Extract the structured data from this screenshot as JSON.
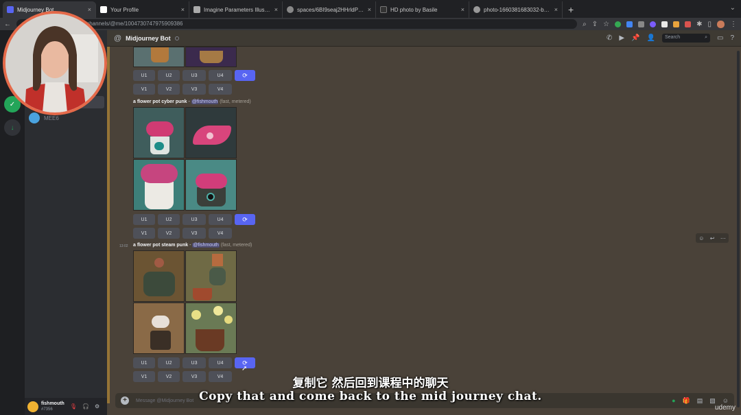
{
  "browser": {
    "tabs": [
      {
        "title": "Midjourney Bot",
        "active": true,
        "color": "#5865f2"
      },
      {
        "title": "Your Profile",
        "active": false,
        "color": "#ffffff"
      },
      {
        "title": "Imagine Parameters Illustrated",
        "active": false,
        "color": "#aaaaaa"
      },
      {
        "title": "spaces/6BI9seaj2HHrldPlMKP",
        "active": false,
        "color": "#888888"
      },
      {
        "title": "HD photo by Basile",
        "active": false,
        "color": "#333333"
      },
      {
        "title": "photo-1660381683032-b9cf",
        "active": false,
        "color": "#999999"
      }
    ],
    "close": "×",
    "new_tab": "+",
    "url": "/channels/@me/1004730747975909386"
  },
  "discord": {
    "channel_title": "Midjourney Bot",
    "search_placeholder": "Search",
    "dm_label": "MEE6",
    "user": {
      "name": "fishmouth",
      "tag": "#7356"
    },
    "composer_placeholder": "Message @Midjourney Bot"
  },
  "messages": [
    {
      "prompt": "",
      "mention": "",
      "meta": "",
      "timestamp": "",
      "upscale": [
        "U1",
        "U2",
        "U3",
        "U4"
      ],
      "variation": [
        "V1",
        "V2",
        "V3",
        "V4"
      ]
    },
    {
      "prompt": "a flower pot cyber punk",
      "separator": " - ",
      "mention": "@fishmouth",
      "meta": " (fast, metered)",
      "timestamp": "",
      "upscale": [
        "U1",
        "U2",
        "U3",
        "U4"
      ],
      "variation": [
        "V1",
        "V2",
        "V3",
        "V4"
      ],
      "tile_colors": [
        "#3f5d5c",
        "#2f3a3c",
        "#3d7f79",
        "#4a8a85"
      ]
    },
    {
      "prompt": "a flower pot steam punk",
      "separator": " - ",
      "mention": "@fishmouth",
      "meta": " (fast, metered)",
      "timestamp": "13:02",
      "upscale": [
        "U1",
        "U2",
        "U3",
        "U4"
      ],
      "variation": [
        "V1",
        "V2",
        "V3",
        "V4"
      ],
      "tile_colors": [
        "#6b5433",
        "#6f6a45",
        "#8a6a47",
        "#6a7a55"
      ]
    }
  ],
  "subtitles": {
    "zh": "复制它 然后回到课程中的聊天",
    "en": "Copy that and come back to the mid journey chat."
  },
  "watermark": "udemy",
  "colors": {
    "accent": "#5865f2",
    "webcam_ring": "#e56a4a",
    "chat_bg": "#4a4239"
  }
}
